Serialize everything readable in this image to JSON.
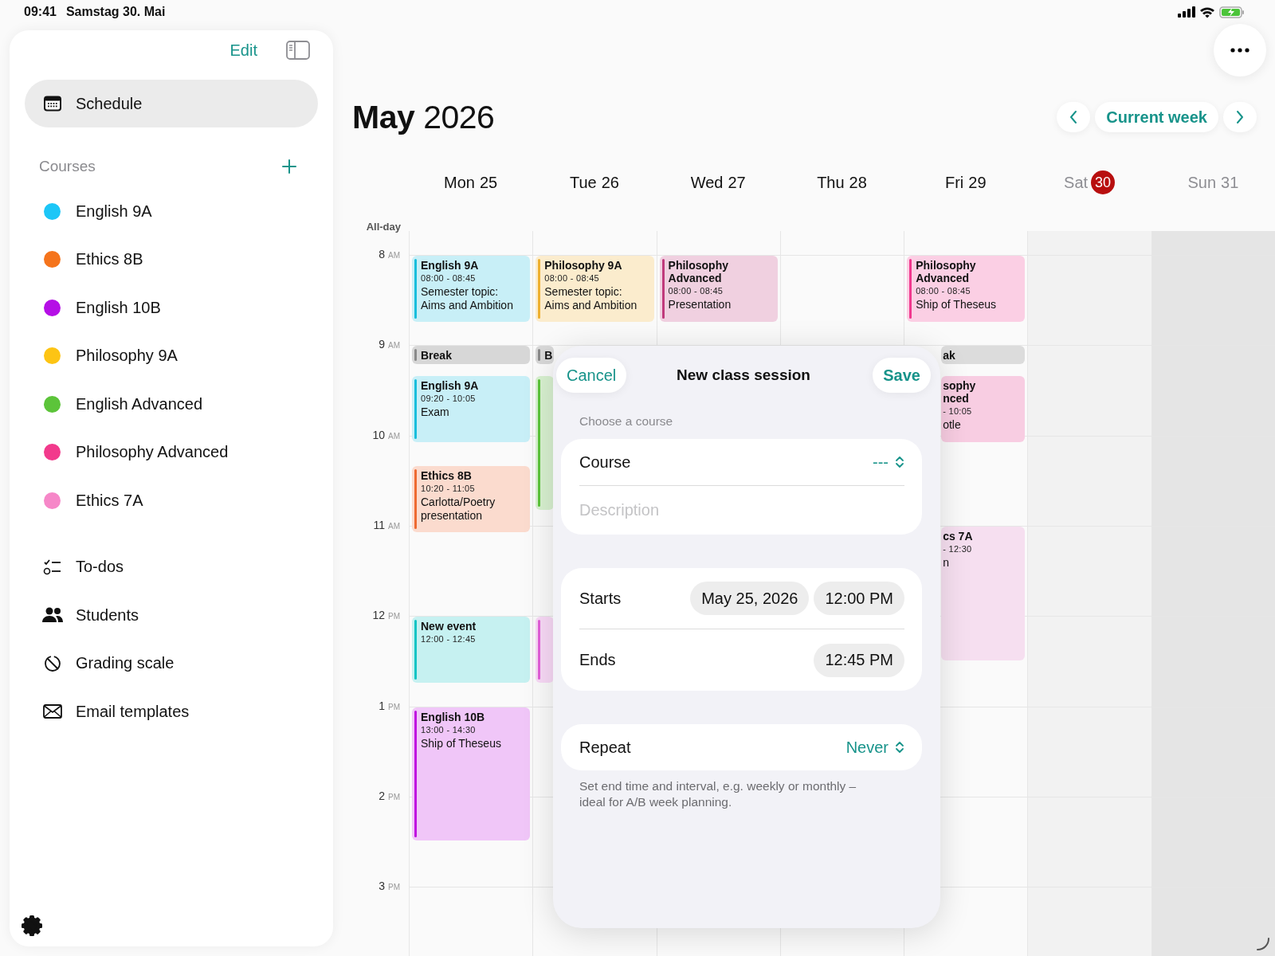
{
  "status_bar": {
    "time": "09:41",
    "date": "Samstag 30. Mai"
  },
  "sidebar": {
    "edit": "Edit",
    "primary": [
      {
        "kind": "calendar",
        "label": "Schedule",
        "selected": true
      }
    ],
    "courses_title": "Courses",
    "courses": [
      {
        "name": "English 9A",
        "color": "#1cc6f7"
      },
      {
        "name": "Ethics 8B",
        "color": "#f5741c"
      },
      {
        "name": "English 10B",
        "color": "#b50fe6"
      },
      {
        "name": "Philosophy 9A",
        "color": "#fdc414"
      },
      {
        "name": "English Advanced",
        "color": "#5cc43a"
      },
      {
        "name": "Philosophy Advanced",
        "color": "#f23a8c"
      },
      {
        "name": "Ethics 7A",
        "color": "#f687c8"
      }
    ],
    "tools": [
      {
        "kind": "todos",
        "label": "To-dos",
        "selected": false
      },
      {
        "kind": "students",
        "label": "Students",
        "selected": false
      },
      {
        "kind": "grading",
        "label": "Grading scale",
        "selected": false
      },
      {
        "kind": "email",
        "label": "Email templates",
        "selected": false
      }
    ]
  },
  "calendar": {
    "title": "**May** 2026",
    "current_week": "Current week",
    "all_day": "All-day",
    "hours": [
      {
        "hour": "8",
        "period": "AM"
      },
      {
        "hour": "9",
        "period": "AM"
      },
      {
        "hour": "10",
        "period": "AM"
      },
      {
        "hour": "11",
        "period": "AM"
      },
      {
        "hour": "12",
        "period": "PM"
      },
      {
        "hour": "1",
        "period": "PM"
      },
      {
        "hour": "2",
        "period": "PM"
      },
      {
        "hour": "3",
        "period": "PM"
      }
    ],
    "days": [
      {
        "label": "Mon",
        "date": "25",
        "today": false,
        "dimmed": false,
        "events": [
          {
            "kind": "event",
            "title": "English 9A",
            "time": "08:00 - 08:45",
            "note": "Semester topic: Aims and Ambition",
            "color": "#19bedc",
            "clipped": false
          },
          {
            "kind": "break",
            "title": "Break",
            "color": "#8a8a8a",
            "clipped": false
          },
          {
            "kind": "event",
            "title": "English 9A",
            "time": "09:20 - 10:05",
            "note": "Exam",
            "color": "#19bedc",
            "clipped": false
          },
          {
            "kind": "event",
            "title": "Ethics 8B",
            "time": "10:20 - 11:05",
            "note": "Carlotta/Poetry presentation",
            "color": "#ee6a32",
            "clipped": false
          },
          {
            "kind": "event",
            "title": "New event",
            "time": "12:00 - 12:45",
            "color": "#12c4c4",
            "clipped": false
          },
          {
            "kind": "event",
            "title": "English 10B",
            "time": "13:00 - 14:30",
            "note": "Ship of Theseus",
            "color": "#c010e0",
            "clipped": false
          }
        ]
      },
      {
        "label": "Tue",
        "date": "26",
        "today": false,
        "dimmed": false,
        "events": [
          {
            "kind": "event",
            "title": "Philosophy 9A",
            "time": "08:00 - 08:45",
            "note": "Semester topic: Aims and Ambition",
            "color": "#eeb030",
            "clipped": false
          },
          {
            "kind": "break",
            "title": "B",
            "color": "#8a8a8a",
            "clipped": true
          },
          {
            "kind": "sliver",
            "color": "#5cc43a",
            "clipped": true
          },
          {
            "kind": "sliver",
            "color": "#e25fd8",
            "clipped": true
          }
        ]
      },
      {
        "label": "Wed",
        "date": "27",
        "today": false,
        "dimmed": false,
        "events": [
          {
            "kind": "event",
            "title": "Philosophy Advanced",
            "time": "08:00 - 08:45",
            "note": "Presentation",
            "color": "#c03a7c",
            "clipped": false
          }
        ]
      },
      {
        "label": "Thu",
        "date": "28",
        "today": false,
        "dimmed": false
      },
      {
        "label": "Fri",
        "date": "29",
        "today": false,
        "dimmed": false,
        "events": [
          {
            "kind": "event",
            "title": "Philosophy Advanced",
            "time": "08:00 - 08:45",
            "note": "Ship of Theseus",
            "color": "#f0388e",
            "clipped": false
          },
          {
            "kind": "break",
            "title": "ak",
            "color": "#dcdcdc",
            "clipped": true
          },
          {
            "kind": "event",
            "title": "sophy\nnced",
            "time": "- 10:05",
            "note": "otle",
            "color": "#f8cde2",
            "clipped": true
          },
          {
            "kind": "event",
            "title": "cs 7A",
            "time": "- 12:30",
            "note": "n",
            "color": "#f6dff0",
            "clipped": true
          }
        ]
      },
      {
        "label": "Sat",
        "date": "30",
        "today": true,
        "dimmed": true,
        "color": "#f2f2f2"
      },
      {
        "label": "Sun",
        "date": "31",
        "today": false,
        "dimmed": true,
        "color": "#e5e5e5"
      }
    ]
  },
  "sheet": {
    "cancel": "Cancel",
    "title": "New class session",
    "save": "Save",
    "section_label": "Choose a course",
    "course": {
      "label": "Course",
      "value": "---"
    },
    "description": {
      "placeholder": "Description"
    },
    "starts": {
      "label": "Starts",
      "date": "May 25, 2026",
      "time": "12:00 PM"
    },
    "ends": {
      "label": "Ends",
      "time": "12:45 PM"
    },
    "repeat": {
      "label": "Repeat",
      "value": "Never"
    },
    "footnote": "Set end time and interval, e.g. weekly or monthly – ideal for A/B week planning."
  }
}
